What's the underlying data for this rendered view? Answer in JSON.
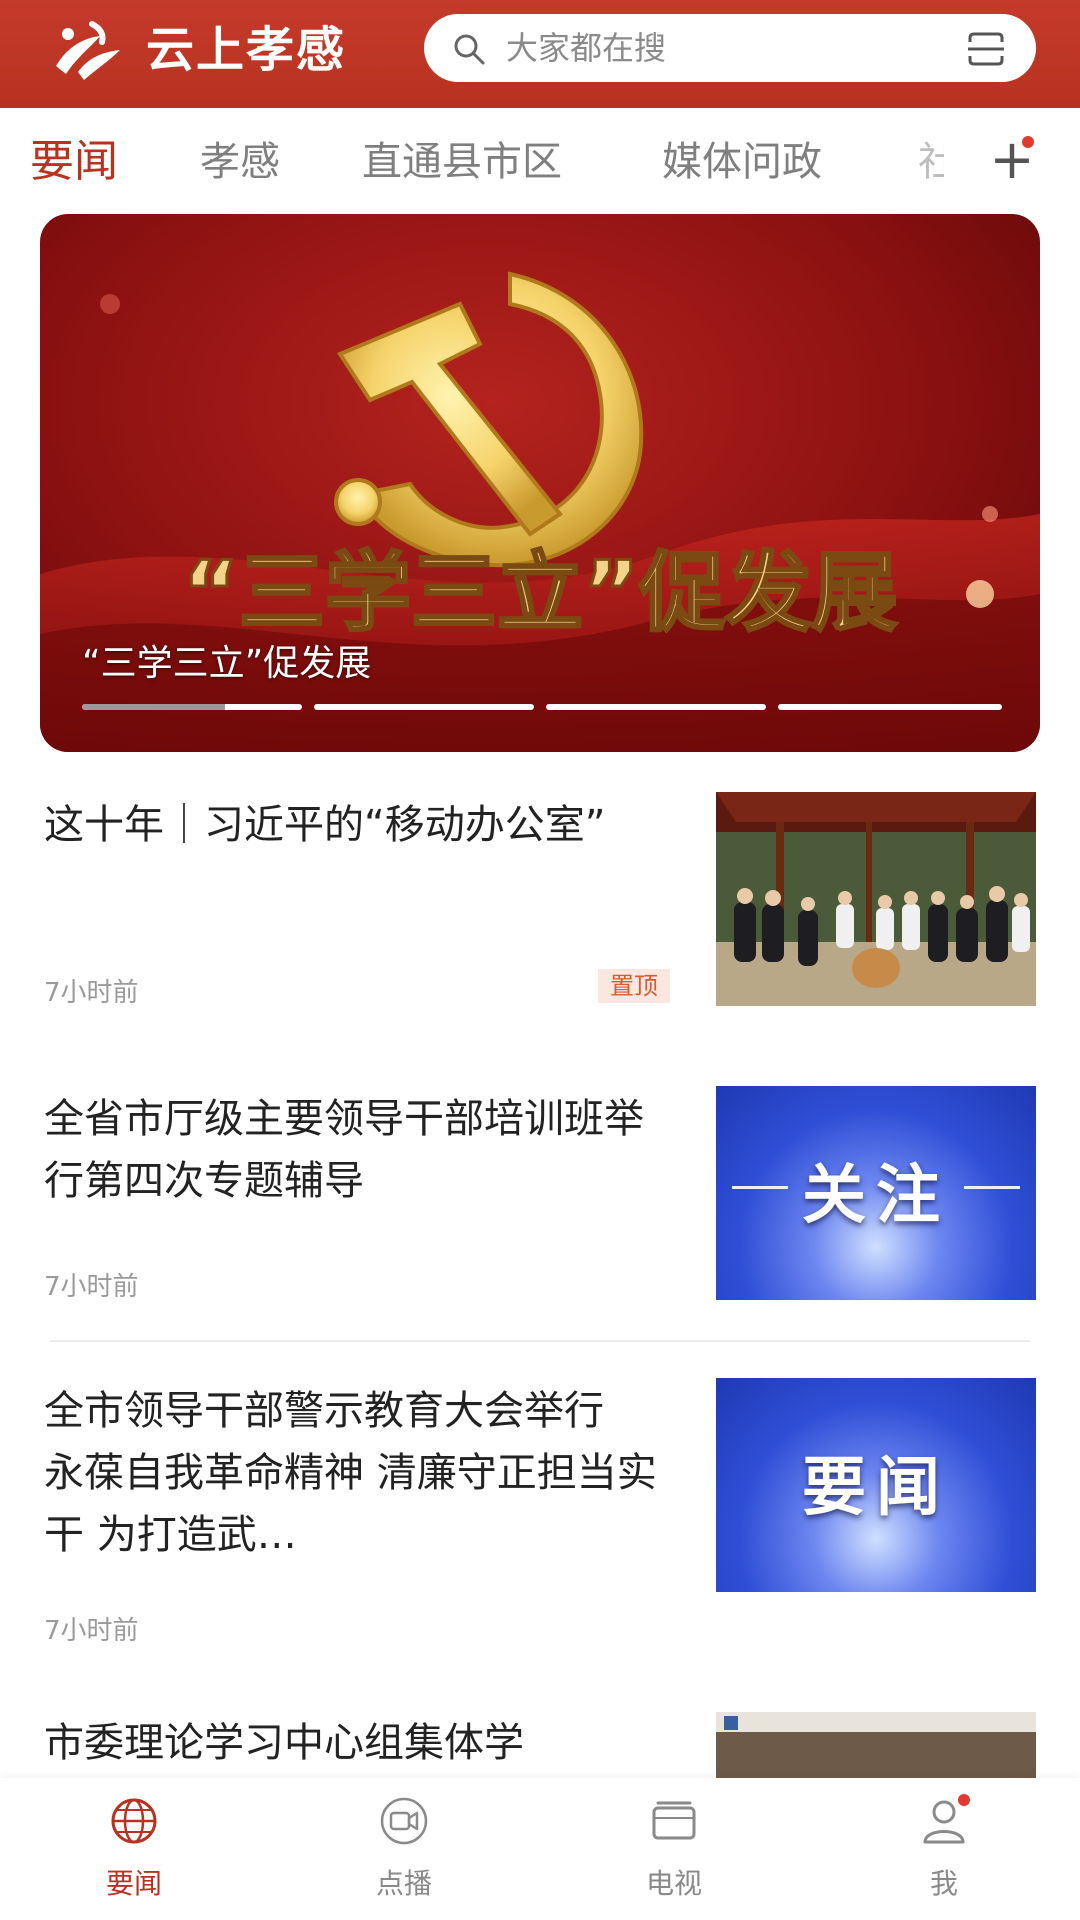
{
  "header": {
    "app_title": "云上孝感",
    "search_placeholder": "大家都在搜",
    "brand_color": "#b8321f"
  },
  "tabs": [
    {
      "label": "要闻",
      "active": true
    },
    {
      "label": "孝感",
      "active": false
    },
    {
      "label": "直通县市区",
      "active": false
    },
    {
      "label": "媒体问政",
      "active": false
    },
    {
      "label": "社",
      "active": false
    }
  ],
  "tabs_more_label": "+",
  "banner": {
    "caption": "“三学三立”促发展",
    "art_text": "“三学三立”促发展",
    "slide_count": 4,
    "active_slide_progress": 0.65
  },
  "news": [
    {
      "title": "这十年｜习近平的“移动办公室”",
      "time": "7小时前",
      "badge": "置顶"
    },
    {
      "title": "全省市厅级主要领导干部培训班举行第四次专题辅导",
      "time": "7小时前",
      "thumb_label": "关注"
    },
    {
      "title": "全市领导干部警示教育大会举行　永葆自我革命精神 清廉守正担当实干 为打造武…",
      "time": "7小时前",
      "thumb_label": "要闻"
    },
    {
      "title": "市委理论学习中心组集体学",
      "time": ""
    }
  ],
  "bottom_nav": [
    {
      "label": "要闻",
      "icon": "globe-icon",
      "active": true
    },
    {
      "label": "点播",
      "icon": "video-camera-icon",
      "active": false
    },
    {
      "label": "电视",
      "icon": "tv-icon",
      "active": false
    },
    {
      "label": "我",
      "icon": "user-icon",
      "active": false
    }
  ]
}
